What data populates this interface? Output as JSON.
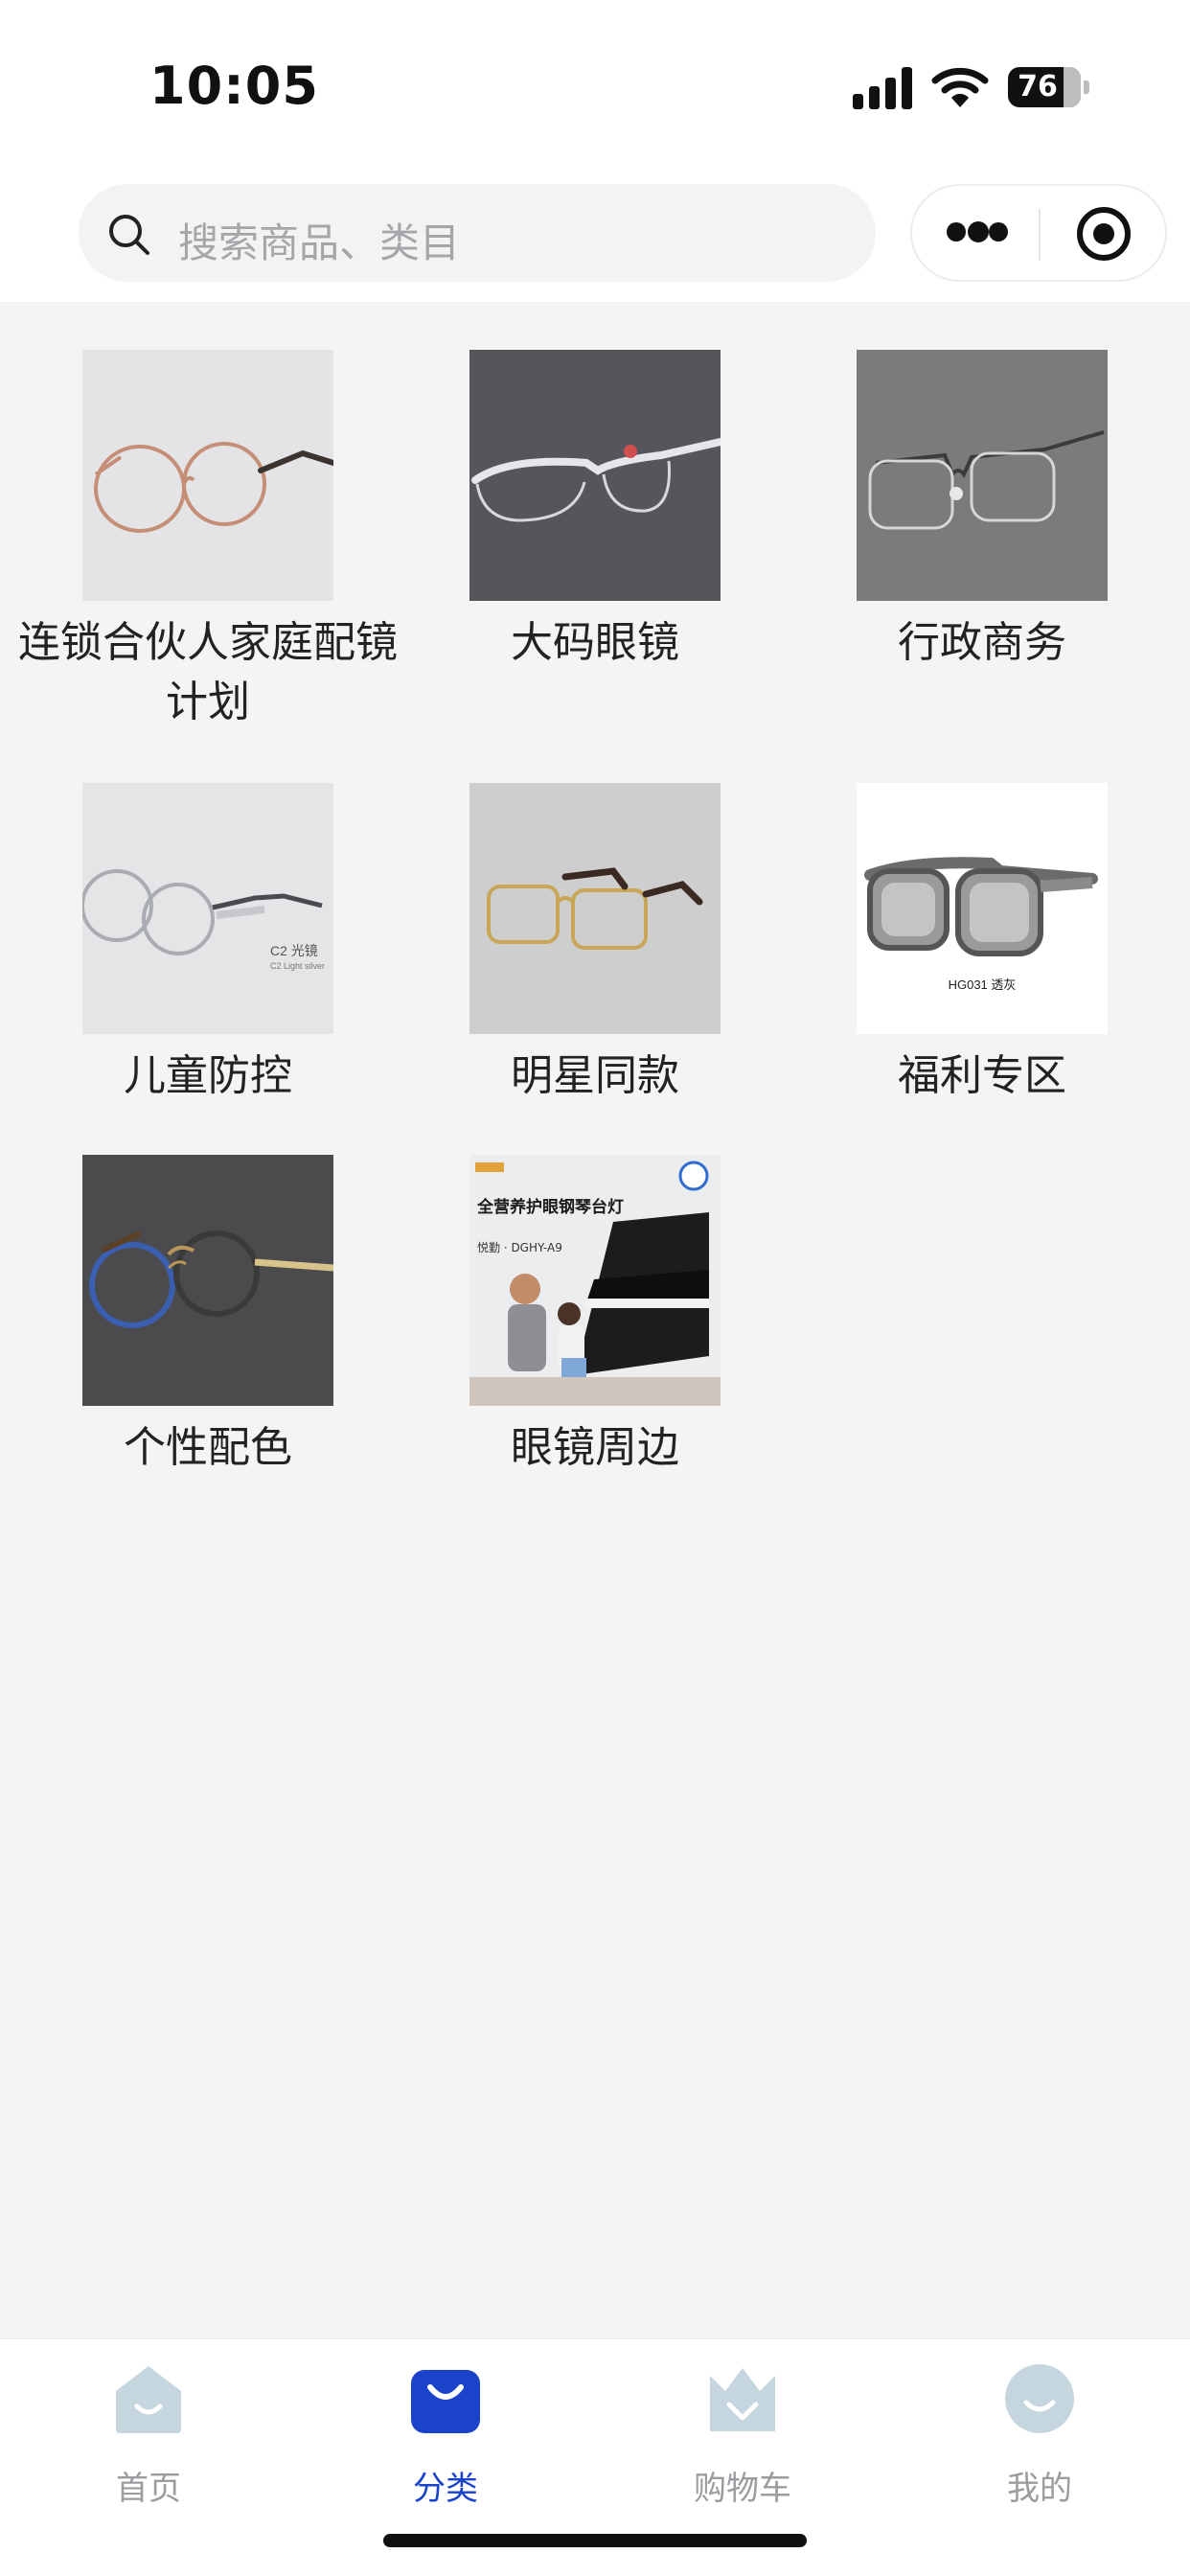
{
  "status_bar": {
    "time": "10:05",
    "battery": "76"
  },
  "search": {
    "placeholder": "搜索商品、类目"
  },
  "categories": [
    {
      "label": "连锁合伙人家庭配镜计划",
      "image": "rose-gold round glasses"
    },
    {
      "label": "大码眼镜",
      "image": "silver semi-rimless glasses"
    },
    {
      "label": "行政商务",
      "image": "grey rimless glasses"
    },
    {
      "label": "儿童防控",
      "image": "silver round kids glasses"
    },
    {
      "label": "明星同款",
      "image": "gold square glasses"
    },
    {
      "label": "福利专区",
      "image": "grey sports goggles",
      "image_caption": "HG031 透灰"
    },
    {
      "label": "个性配色",
      "image": "blue and gold double-bridge glasses"
    },
    {
      "label": "眼镜周边",
      "image": "piano lamp advertisement",
      "image_title": "全营养护眼钢琴台灯",
      "image_model": "悦勤 · DGHY-A9"
    }
  ],
  "tabbar": [
    {
      "label": "首页",
      "icon": "home-icon",
      "active": false
    },
    {
      "label": "分类",
      "icon": "category-bag-icon",
      "active": true
    },
    {
      "label": "购物车",
      "icon": "cart-icon",
      "active": false
    },
    {
      "label": "我的",
      "icon": "profile-icon",
      "active": false
    }
  ],
  "colors": {
    "accent": "#1b43c9",
    "inactive_tab": "#9a9ca0",
    "background": "#f4f4f5"
  }
}
